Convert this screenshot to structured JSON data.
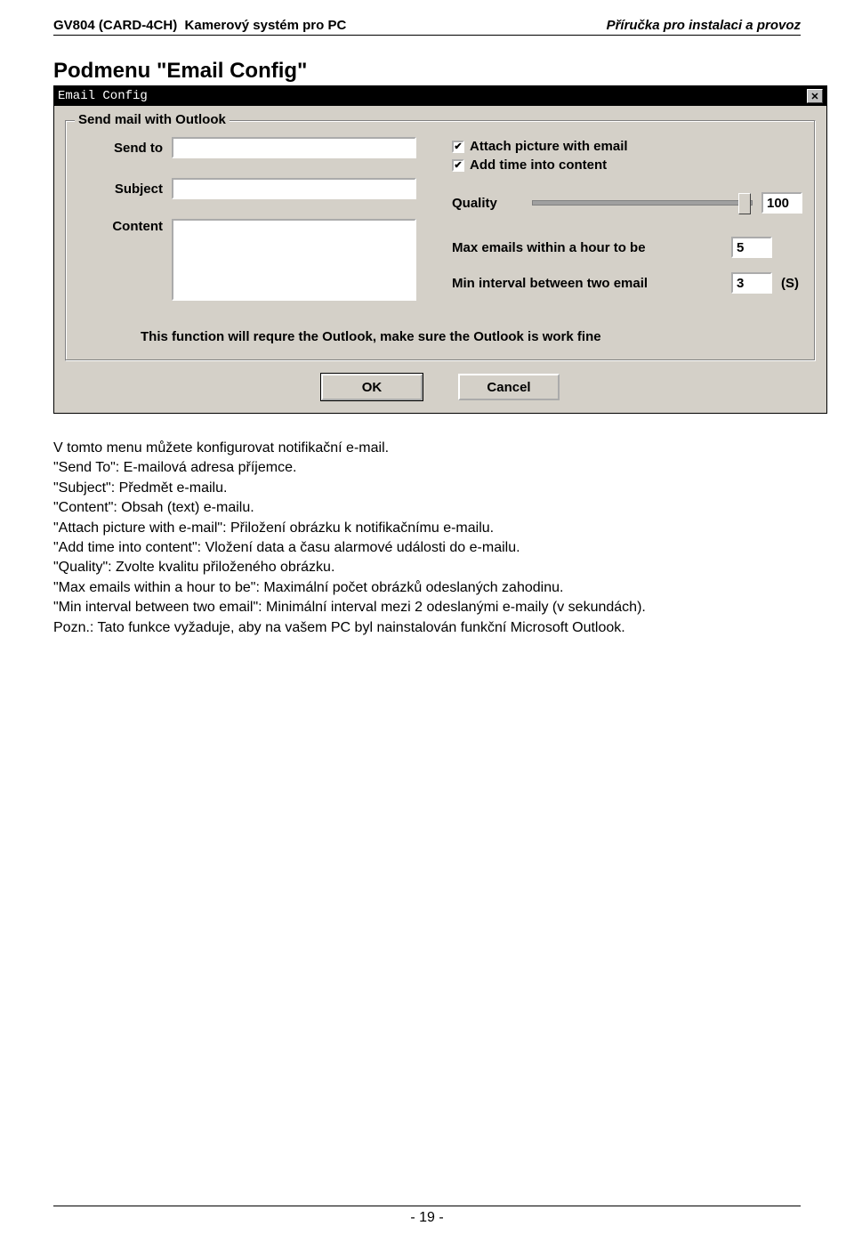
{
  "header": {
    "model": "GV804 (CARD-4CH)",
    "product": "Kamerový systém pro PC",
    "doc_type": "Příručka pro instalaci a provoz"
  },
  "title": "Podmenu \"Email Config\"",
  "dialog": {
    "titlebar": "Email Config",
    "groupbox_legend": "Send mail with Outlook",
    "send_to_label": "Send to",
    "subject_label": "Subject",
    "content_label": "Content",
    "cb_attach": "Attach picture with email",
    "cb_addtime": "Add time into content",
    "quality_label": "Quality",
    "quality_value": "100",
    "max_emails_label": "Max emails within a hour to be",
    "max_emails_value": "5",
    "min_interval_label": "Min interval between two email",
    "min_interval_value": "3",
    "min_interval_unit": "(S)",
    "note": "This function will requre the Outlook, make sure the Outlook is work fine",
    "ok": "OK",
    "cancel": "Cancel"
  },
  "explain": {
    "l1": "V tomto menu můžete konfigurovat notifikační e-mail.",
    "l2": "\"Send To\": E-mailová adresa příjemce.",
    "l3": "\"Subject\": Předmět e-mailu.",
    "l4": "\"Content\": Obsah (text) e-mailu.",
    "l5": "\"Attach picture with e-mail\": Přiložení obrázku k notifikačnímu e-mailu.",
    "l6": "\"Add time into content\": Vložení data a času alarmové události do e-mailu.",
    "l7": "\"Quality\": Zvolte kvalitu přiloženého obrázku.",
    "l8": "\"Max emails within a hour to be\": Maximální počet obrázků odeslaných zahodinu.",
    "l9": "\"Min interval between two email\": Minimální interval mezi 2 odeslanými e-maily (v sekundách).",
    "l10": "Pozn.: Tato funkce vyžaduje, aby na vašem PC byl nainstalován funkční Microsoft Outlook."
  },
  "footer": {
    "page": "- 19 -"
  }
}
